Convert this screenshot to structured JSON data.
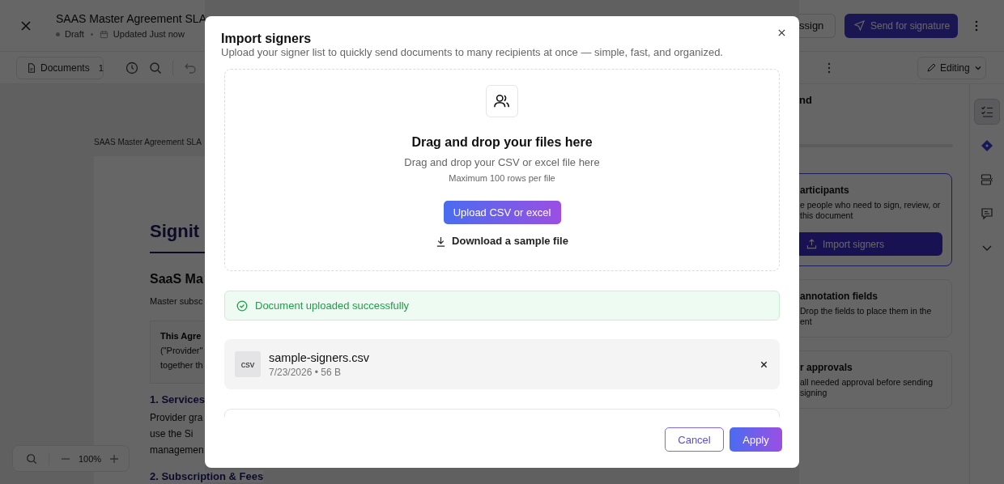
{
  "header": {
    "title": "SAAS Master Agreement SLA",
    "status": "Draft",
    "updated": "Updated Just now",
    "assign_button": "ssign",
    "send_button": "Send for signature"
  },
  "toolbar": {
    "documents_label": "Documents",
    "documents_count": "1",
    "mode": "Editing"
  },
  "document": {
    "page_label": "SAAS Master Agreement SLA",
    "brand": "Signit",
    "title": "SaaS Ma",
    "subtitle": "Master subsc",
    "intro": [
      "This Agre",
      "(\"Provider\"",
      "together th"
    ],
    "sections": [
      {
        "heading": "1. Services",
        "lines": [
          "Provider gra",
          "use the Si",
          "managemen"
        ]
      },
      {
        "heading": "2. Subscription & Fees"
      }
    ]
  },
  "zoom": {
    "level_text": "100%"
  },
  "side_panel": {
    "title": "nd",
    "steps": [
      {
        "title": "articipants",
        "text": "e people who need to sign, review, or\nthis document",
        "button": "Import signers",
        "selected": true
      },
      {
        "title": "annotation fields",
        "text": "Drop the fields to place them in the\nent",
        "selected": false
      },
      {
        "title": "r approvals",
        "text": "all needed approval before sending\nsigning",
        "selected": false
      }
    ]
  },
  "rail": [
    {
      "kind": "checklist",
      "selected": true
    },
    {
      "kind": "diamond",
      "selected": false
    },
    {
      "kind": "form",
      "selected": false
    },
    {
      "kind": "comment",
      "selected": false
    },
    {
      "kind": "chevron",
      "selected": false
    }
  ],
  "modal": {
    "title": "Import signers",
    "subtitle": "Upload your signer list to quickly send documents to many recipients at once — simple, fast, and organized.",
    "dropzone": {
      "title": "Drag and drop your files here",
      "hint": "Drag and drop your CSV or excel file here",
      "limit": "Maximum 100 rows per file",
      "upload_button": "Upload CSV or excel",
      "sample_link": "Download a sample file"
    },
    "banner": {
      "kind": "success",
      "text": "Document uploaded successfully"
    },
    "file": {
      "type": "csv",
      "name": "sample-signers.csv",
      "meta": "7/23/2026 • 56 B"
    },
    "buttons": {
      "cancel": "Cancel",
      "apply": "Apply"
    }
  }
}
